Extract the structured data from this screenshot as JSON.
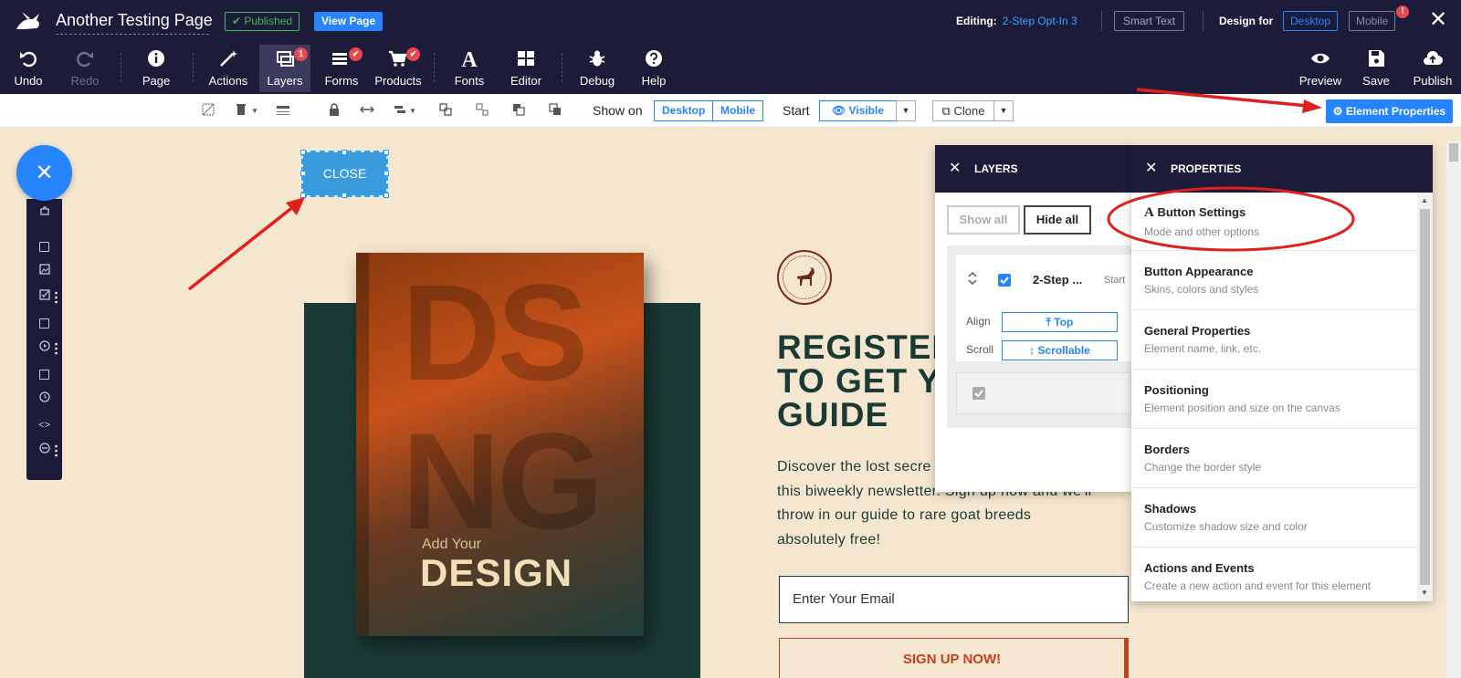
{
  "header": {
    "page_title": "Another Testing Page",
    "status_badge": "✔ Published",
    "view_page_label": "View Page",
    "editing_label": "Editing:",
    "editing_value": "2-Step Opt-In 3",
    "smart_text_label": "Smart Text",
    "design_for_label": "Design for",
    "desktop_label": "Desktop",
    "mobile_label": "Mobile",
    "mobile_warning": "!",
    "close_glyph": "✕"
  },
  "toolbar": {
    "undo": "Undo",
    "redo": "Redo",
    "page": "Page",
    "actions": "Actions",
    "layers": "Layers",
    "layers_badge": "1",
    "forms": "Forms",
    "products": "Products",
    "fonts": "Fonts",
    "editor": "Editor",
    "debug": "Debug",
    "help": "Help",
    "preview": "Preview",
    "save": "Save",
    "publish": "Publish"
  },
  "subbar": {
    "show_on_label": "Show on",
    "show_desktop": "Desktop",
    "show_mobile": "Mobile",
    "start_label": "Start",
    "visible_label": "Visible",
    "clone_label": "Clone",
    "element_properties_label": "⚙ Element Properties"
  },
  "palette": {
    "fab_glyph": "✕"
  },
  "canvas": {
    "close_button_label": "CLOSE",
    "book_big_1": "DS",
    "book_big_2": "NG",
    "book_sub": "Add Your",
    "book_title": "DESIGN",
    "headline_1": "REGISTER",
    "headline_2": "TO GET Y",
    "headline_3": "GUIDE",
    "body_1": "Discover the lost secre",
    "body_2": "this biweekly newsletter.  Sign up now and we'll",
    "body_3": "throw in our guide to rare goat breeds",
    "body_4": "absolutely free!",
    "email_placeholder": "Enter Your Email",
    "signup_label": "SIGN UP NOW!"
  },
  "layers_panel": {
    "title": "LAYERS",
    "show_all": "Show all",
    "hide_all": "Hide all",
    "layer_name": "2-Step ...",
    "layer_start": "Start",
    "align_label": "Align",
    "align_value": "Top",
    "scroll_label": "Scroll",
    "scroll_value": "Scrollable"
  },
  "properties_panel": {
    "title": "PROPERTIES",
    "items": [
      {
        "title": "Button Settings",
        "desc": "Mode and other options"
      },
      {
        "title": "Button Appearance",
        "desc": "Skins, colors and styles"
      },
      {
        "title": "General Properties",
        "desc": "Element name, link, etc."
      },
      {
        "title": "Positioning",
        "desc": "Element position and size on the canvas"
      },
      {
        "title": "Borders",
        "desc": "Change the border style"
      },
      {
        "title": "Shadows",
        "desc": "Customize shadow size and color"
      },
      {
        "title": "Actions and Events",
        "desc": "Create a new action and event for this element"
      }
    ]
  },
  "colors": {
    "header_bg": "#1c1b3a",
    "accent": "#2684ff",
    "canvas_bg": "#f5e6cf",
    "brand_green": "#1a3a35",
    "brand_orange": "#c2421a",
    "annotation_red": "#e0201c"
  }
}
